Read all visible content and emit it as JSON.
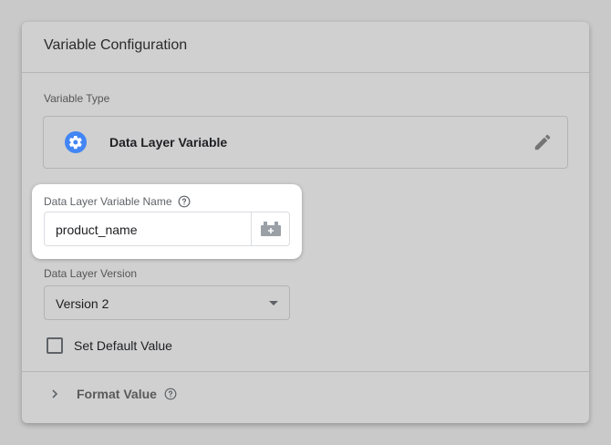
{
  "card": {
    "title": "Variable Configuration"
  },
  "variable_type": {
    "label": "Variable Type",
    "name": "Data Layer Variable",
    "icon": "gear-icon",
    "icon_color": "#4285f4"
  },
  "variable_name": {
    "label": "Data Layer Variable Name",
    "value": "product_name"
  },
  "version": {
    "label": "Data Layer Version",
    "selected": "Version 2"
  },
  "default_value": {
    "label": "Set Default Value",
    "checked": false
  },
  "format_value": {
    "label": "Format Value"
  }
}
